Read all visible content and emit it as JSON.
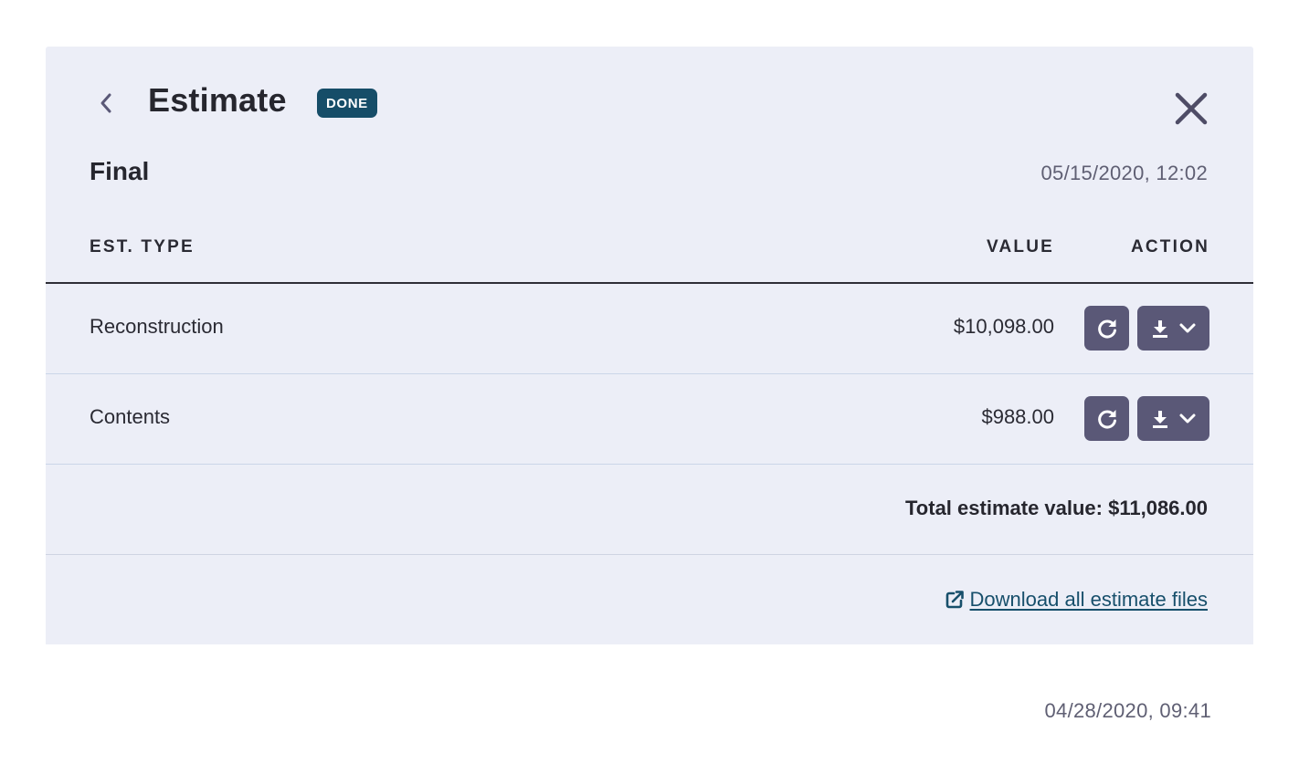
{
  "header": {
    "title": "Estimate",
    "status_badge": "DONE"
  },
  "estimate": {
    "label": "Final",
    "timestamp": "05/15/2020, 12:02"
  },
  "table": {
    "columns": [
      "EST. TYPE",
      "VALUE",
      "ACTION"
    ],
    "rows": [
      {
        "type": "Reconstruction",
        "value": "$10,098.00"
      },
      {
        "type": "Contents",
        "value": "$988.00"
      }
    ]
  },
  "total": {
    "text": "Total estimate value: $11,086.00"
  },
  "download_all": {
    "label": "Download all estimate files"
  },
  "previous_estimate": {
    "timestamp": "04/28/2020, 09:41"
  },
  "icons": {
    "back": "chevron-left-icon",
    "close": "close-icon",
    "refresh": "refresh-icon",
    "download": "download-icon",
    "dropdown": "chevron-down-icon",
    "external": "external-link-icon"
  },
  "colors": {
    "panel_background": "#eceef7",
    "badge_background": "#164d68",
    "action_button": "#5a5877",
    "link": "#174f6b",
    "muted_text": "#5f5f73"
  }
}
